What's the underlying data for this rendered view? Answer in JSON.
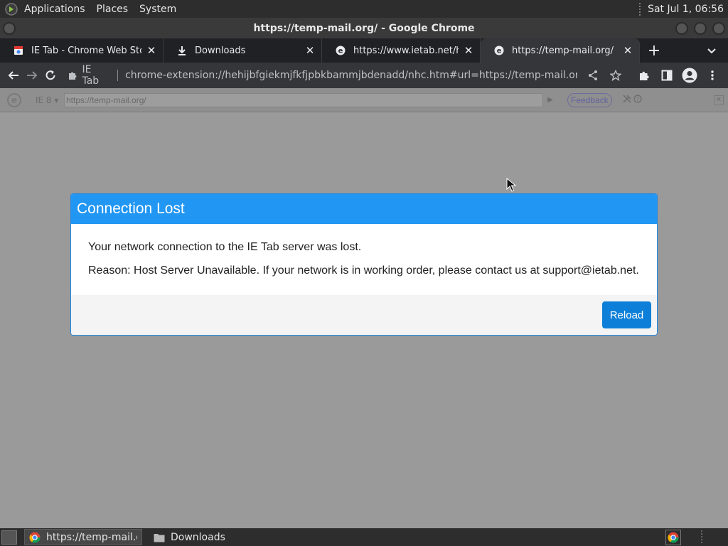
{
  "top_panel": {
    "menus": [
      "Applications",
      "Places",
      "System"
    ],
    "clock": "Sat Jul  1, 06:56"
  },
  "window": {
    "title": "https://temp-mail.org/ - Google Chrome"
  },
  "tabs": [
    {
      "label": "IE Tab - Chrome Web Store",
      "icon": "chrome-web-store-icon",
      "active": false
    },
    {
      "label": "Downloads",
      "icon": "download-icon",
      "active": false
    },
    {
      "label": "https://www.ietab.net/hoste",
      "icon": "ie-tab-icon",
      "active": false
    },
    {
      "label": "https://temp-mail.org/",
      "icon": "ie-tab-icon",
      "active": true
    }
  ],
  "toolbar": {
    "extension_label": "IE Tab",
    "url": "chrome-extension://hehijbfgiekmjfkfjpbkbammjbdenadd/nhc.htm#url=https://temp-mail.org/"
  },
  "ietab_bar": {
    "version": "IE 8 ▾",
    "address": "https://temp-mail.org/",
    "feedback_label": "Feedback"
  },
  "modal": {
    "title": "Connection Lost",
    "line1": "Your network connection to the IE Tab server was lost.",
    "line2": "Reason: Host Server Unavailable. If your network is in working order, please contact us at support@ietab.net.",
    "reload_label": "Reload"
  },
  "taskbar": {
    "tasks": [
      {
        "label": "https://temp-mail.o...",
        "icon": "chrome-icon",
        "active": true
      },
      {
        "label": "Downloads",
        "icon": "folder-icon",
        "active": false
      }
    ]
  },
  "colors": {
    "modal_header": "#2196f3",
    "reload_button": "#0d7fd8",
    "chrome_dark": "#35363a"
  }
}
